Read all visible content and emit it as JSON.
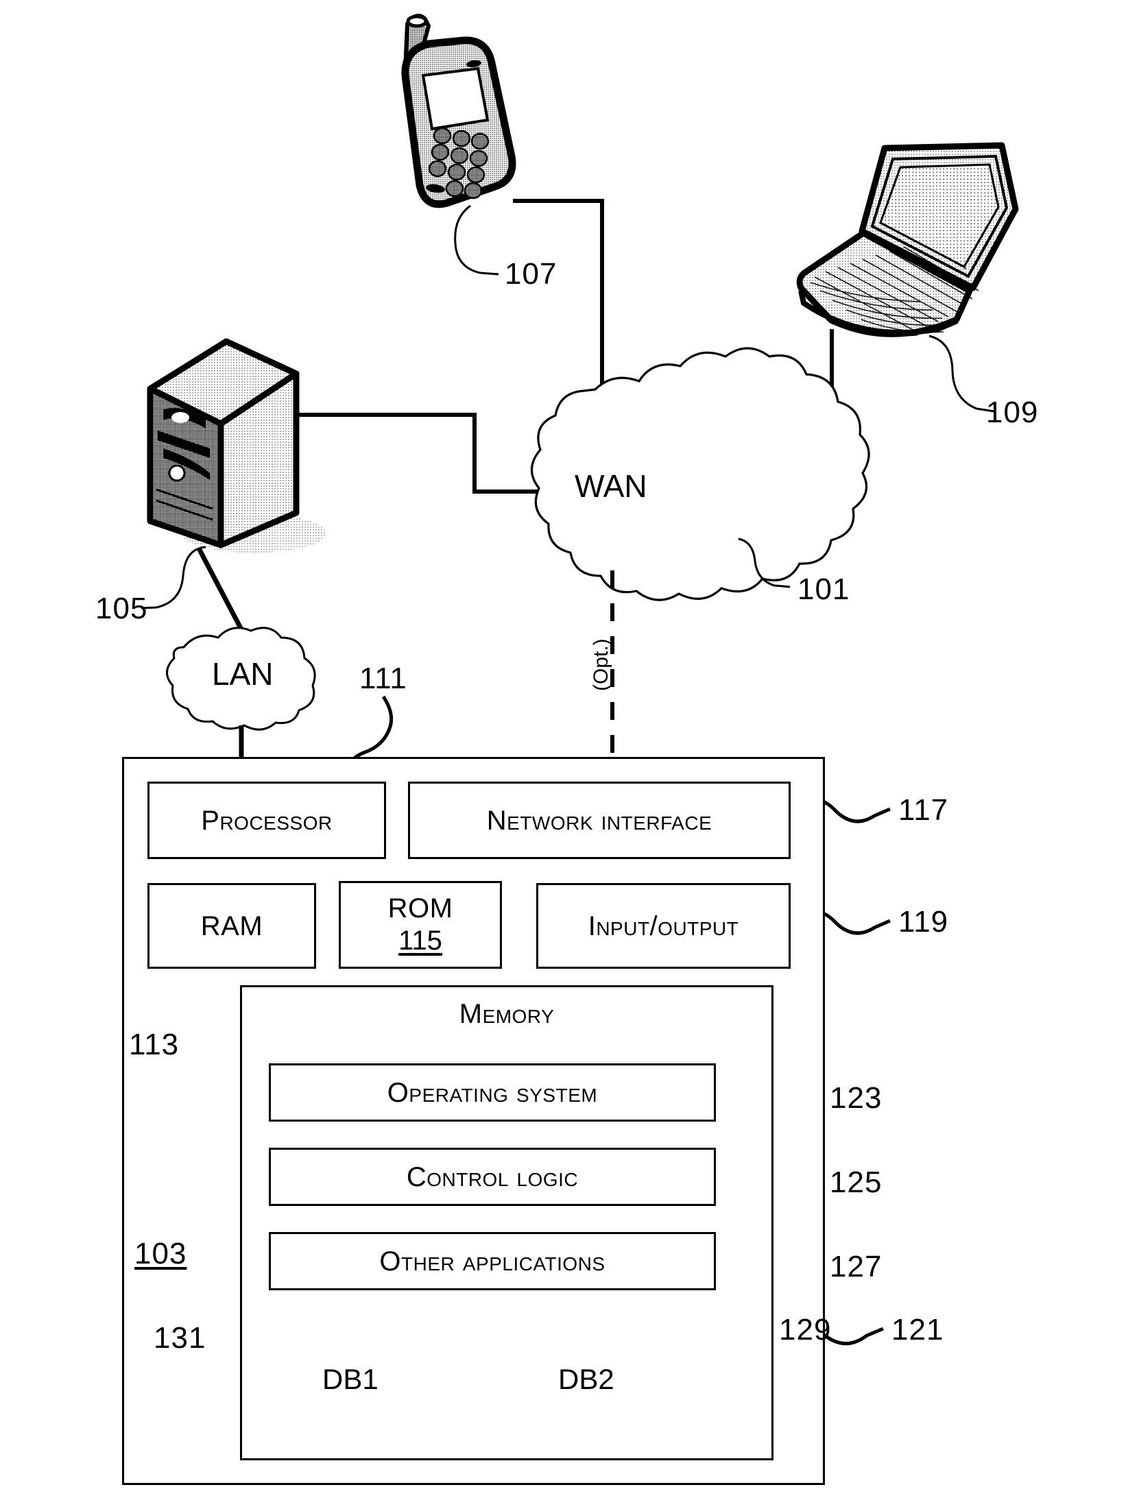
{
  "figure": {
    "title": "Network computing environment block diagram",
    "line_color": "#000000",
    "background": "#ffffff"
  },
  "network": {
    "wan_label": "WAN",
    "lan_label": "LAN",
    "optional_link_label": "(Opt.)"
  },
  "devices": {
    "mobile_phone": {
      "ref": "107"
    },
    "laptop": {
      "ref": "109"
    },
    "server_tower": {
      "ref": "105"
    },
    "wan_cloud": {
      "ref": "101"
    }
  },
  "system": {
    "ref": "103",
    "components": [
      {
        "label": "Processor",
        "ref": "111"
      },
      {
        "label": "Network interface",
        "ref": "117"
      },
      {
        "label": "RAM",
        "ref": "113"
      },
      {
        "label": "ROM",
        "ref": "115"
      },
      {
        "label": "Input/output",
        "ref": "119"
      }
    ],
    "memory": {
      "label": "Memory",
      "ref": "121",
      "modules": [
        {
          "label": "Operating system",
          "ref": "123"
        },
        {
          "label": "Control logic",
          "ref": "125"
        },
        {
          "label": "Other applications",
          "ref": "127"
        }
      ],
      "databases": [
        {
          "label": "DB1",
          "ref": "131"
        },
        {
          "label": "DB2",
          "ref": "129"
        }
      ]
    }
  },
  "ref_numbers": {
    "n101": "101",
    "n103": "103",
    "n105": "105",
    "n107": "107",
    "n109": "109",
    "n111": "111",
    "n113": "113",
    "n115": "115",
    "n117": "117",
    "n119": "119",
    "n121": "121",
    "n123": "123",
    "n125": "125",
    "n127": "127",
    "n129": "129",
    "n131": "131"
  },
  "labels": {
    "processor": "Processor",
    "network_interface": "Network interface",
    "ram": "RAM",
    "rom": "ROM",
    "input_output": "Input/output",
    "memory": "Memory",
    "operating_system": "Operating system",
    "control_logic": "Control logic",
    "other_applications": "Other applications",
    "db1": "DB1",
    "db2": "DB2",
    "wan": "WAN",
    "lan": "LAN",
    "opt": "(Opt.)"
  }
}
